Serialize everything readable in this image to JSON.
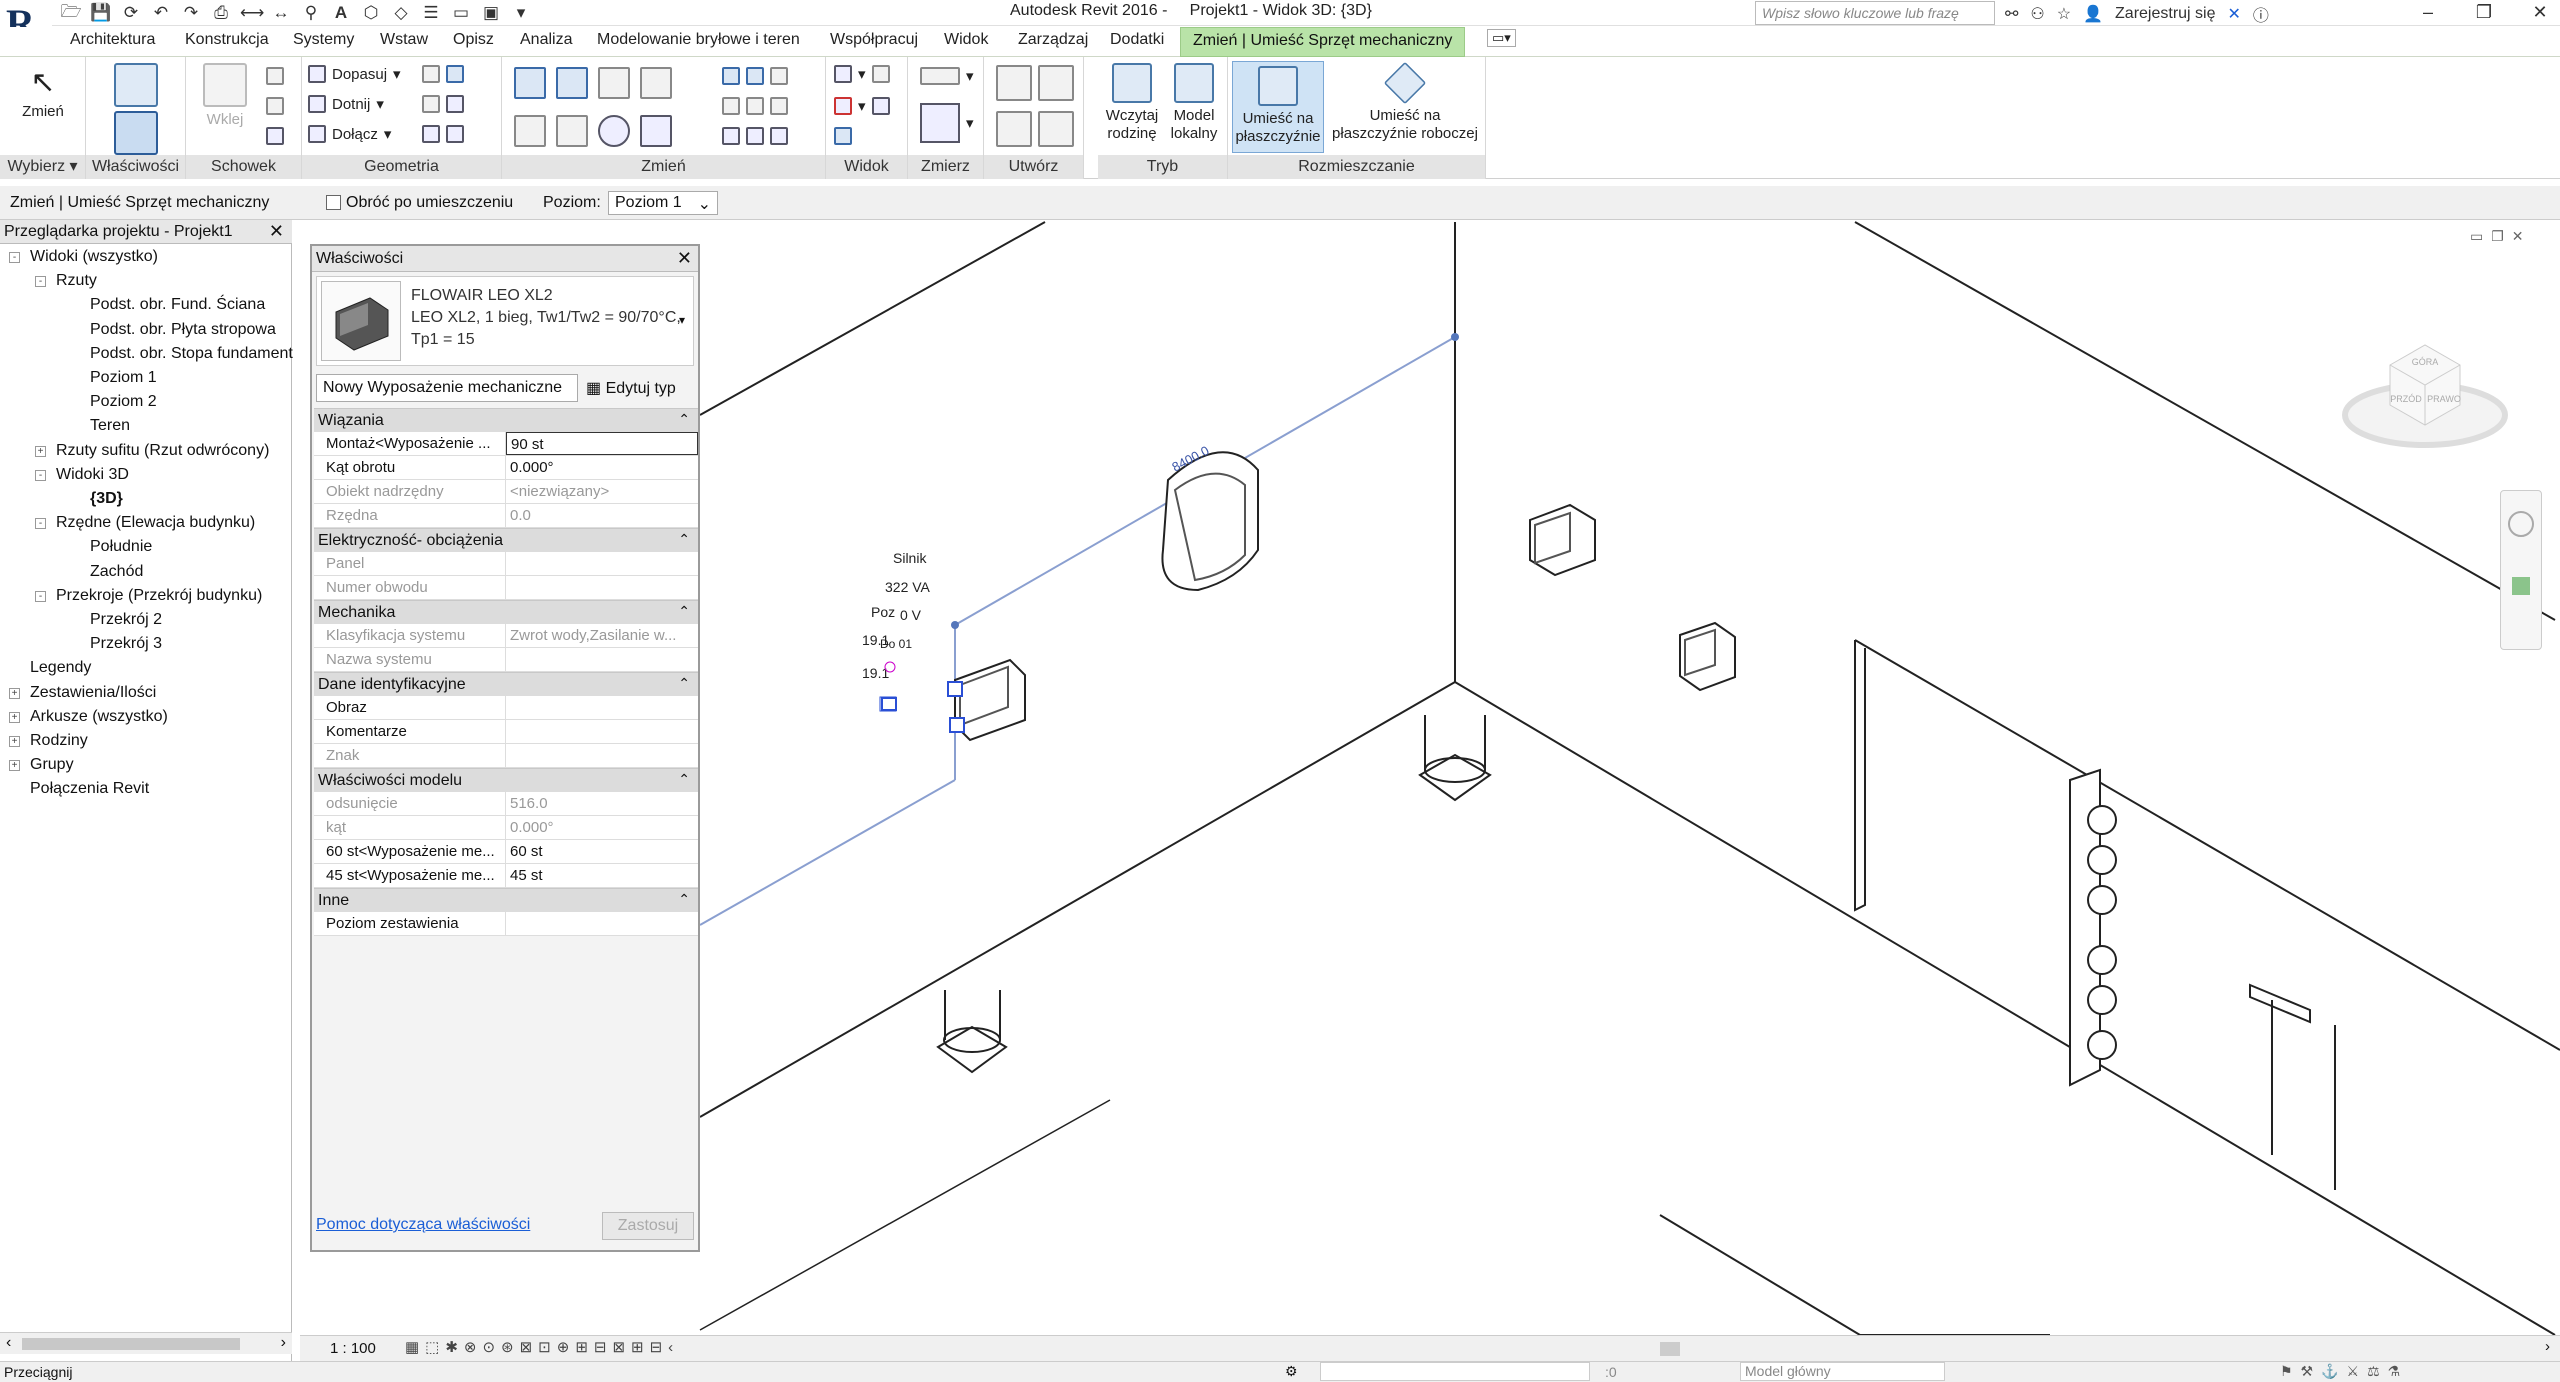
{
  "titlebar": {
    "app_title": "Autodesk Revit 2016 -     Projekt1 - Widok 3D: {3D}",
    "search_placeholder": "Wpisz słowo kluczowe lub frazę",
    "sign_in": "Zarejestruj się"
  },
  "tabs": [
    "Architektura",
    "Konstrukcja",
    "Systemy",
    "Wstaw",
    "Opisz",
    "Analiza",
    "Modelowanie bryłowe i teren",
    "Współpracuj",
    "Widok",
    "Zarządzaj",
    "Dodatki"
  ],
  "active_tab": "Zmień | Umieść Sprzęt mechaniczny",
  "ribbon": {
    "select_label": "Zmień",
    "paste_label": "Wklej",
    "dopasuj": "Dopasuj",
    "dotnij": "Dotnij",
    "dolacz": "Dołącz",
    "wczytaj_rodzine": "Wczytaj rodzinę",
    "model_lokalny": "Model lokalny",
    "umiesc_pl": "Umieść na płaszczyźnie",
    "umiesc_pl_rob": "Umieść na płaszczyźnie roboczej",
    "groups": {
      "wybierz": "Wybierz",
      "wlasciwosci": "Właściwości",
      "schowek": "Schowek",
      "geometria": "Geometria",
      "zmien": "Zmień",
      "widok": "Widok",
      "zmierz": "Zmierz",
      "utworz": "Utwórz",
      "tryb": "Tryb",
      "rozmieszczanie": "Rozmieszczanie"
    }
  },
  "optbar": {
    "context": "Zmień | Umieść Sprzęt mechaniczny",
    "rotate": "Obróć po umieszczeniu",
    "level_label": "Poziom:",
    "level_value": "Poziom 1"
  },
  "browser": {
    "title": "Przeglądarka projektu - Projekt1",
    "items": [
      {
        "label": "Widoki (wszystko)",
        "level": 0,
        "exp": "-"
      },
      {
        "label": "Rzuty",
        "level": 1,
        "exp": "-"
      },
      {
        "label": "Podst. obr. Fund. Ściana",
        "level": 2,
        "exp": ""
      },
      {
        "label": "Podst. obr. Płyta stropowa",
        "level": 2,
        "exp": ""
      },
      {
        "label": "Podst. obr. Stopa fundament",
        "level": 2,
        "exp": ""
      },
      {
        "label": "Poziom 1",
        "level": 2,
        "exp": ""
      },
      {
        "label": "Poziom 2",
        "level": 2,
        "exp": ""
      },
      {
        "label": "Teren",
        "level": 2,
        "exp": ""
      },
      {
        "label": "Rzuty sufitu (Rzut odwrócony)",
        "level": 1,
        "exp": "+"
      },
      {
        "label": "Widoki 3D",
        "level": 1,
        "exp": "-"
      },
      {
        "label": "{3D}",
        "level": 2,
        "exp": "",
        "bold": true
      },
      {
        "label": "Rzędne (Elewacja budynku)",
        "level": 1,
        "exp": "-"
      },
      {
        "label": "Południe",
        "level": 2,
        "exp": ""
      },
      {
        "label": "Zachód",
        "level": 2,
        "exp": ""
      },
      {
        "label": "Przekroje (Przekrój budynku)",
        "level": 1,
        "exp": "-"
      },
      {
        "label": "Przekrój 2",
        "level": 2,
        "exp": ""
      },
      {
        "label": "Przekrój 3",
        "level": 2,
        "exp": ""
      },
      {
        "label": "Legendy",
        "level": 0,
        "exp": ""
      },
      {
        "label": "Zestawienia/Ilości",
        "level": 0,
        "exp": "+"
      },
      {
        "label": "Arkusze (wszystko)",
        "level": 0,
        "exp": "+"
      },
      {
        "label": "Rodziny",
        "level": 0,
        "exp": "+"
      },
      {
        "label": "Grupy",
        "level": 0,
        "exp": "+"
      },
      {
        "label": "Połączenia Revit",
        "level": 0,
        "exp": ""
      }
    ]
  },
  "props": {
    "title": "Właściwości",
    "type_name": "FLOWAIR LEO XL2",
    "type_desc": "LEO XL2, 1 bieg, Tw1/Tw2 = 90/70°C, Tp1 = 15",
    "instance_sel": "Nowy Wyposażenie mechaniczne",
    "edit_type": "Edytuj typ",
    "sections": [
      {
        "name": "Wiązania",
        "rows": [
          {
            "k": "Montaż<Wyposażenie ...",
            "v": "90 st",
            "edit": true
          },
          {
            "k": "Kąt obrotu",
            "v": "0.000°"
          },
          {
            "k": "Obiekt nadrzędny",
            "v": "<niezwiązany>",
            "ro": true
          },
          {
            "k": "Rzędna",
            "v": "0.0",
            "ro": true
          }
        ]
      },
      {
        "name": "Elektryczność- obciążenia",
        "rows": [
          {
            "k": "Panel",
            "v": "",
            "ro": true
          },
          {
            "k": "Numer obwodu",
            "v": "",
            "ro": true
          }
        ]
      },
      {
        "name": "Mechanika",
        "rows": [
          {
            "k": "Klasyfikacja systemu",
            "v": "Zwrot wody,Zasilanie w...",
            "ro": true
          },
          {
            "k": "Nazwa systemu",
            "v": "",
            "ro": true
          }
        ]
      },
      {
        "name": "Dane identyfikacyjne",
        "rows": [
          {
            "k": "Obraz",
            "v": ""
          },
          {
            "k": "Komentarze",
            "v": ""
          },
          {
            "k": "Znak",
            "v": "",
            "ro": true
          }
        ]
      },
      {
        "name": "Właściwości modelu",
        "rows": [
          {
            "k": "odsunięcie",
            "v": "516.0",
            "ro": true
          },
          {
            "k": "kąt",
            "v": "0.000°",
            "ro": true
          },
          {
            "k": "60 st<Wyposażenie me...",
            "v": "60 st"
          },
          {
            "k": "45 st<Wyposażenie me...",
            "v": "45 st"
          }
        ]
      },
      {
        "name": "Inne",
        "rows": [
          {
            "k": "Poziom zestawienia",
            "v": ""
          }
        ]
      }
    ],
    "help_link": "Pomoc dotycząca właściwości",
    "apply": "Zastosuj"
  },
  "viewport": {
    "tag_motor": "Silnik",
    "tag_va": "322 VA",
    "tag_poz": "Poz",
    "tag_v": "0 V",
    "tag_19a": "19.1",
    "tag_dia": "Do 01",
    "tag_19b": "19.1",
    "tag_dim": "8400.0",
    "cube_front": "PRZÓD",
    "cube_right": "PRAWO",
    "cube_top": "GÓRA"
  },
  "viewbar": {
    "scale": "1 : 100"
  },
  "status": {
    "left": "Przeciągnij",
    "model": "Model główny",
    "zero": ":0"
  }
}
